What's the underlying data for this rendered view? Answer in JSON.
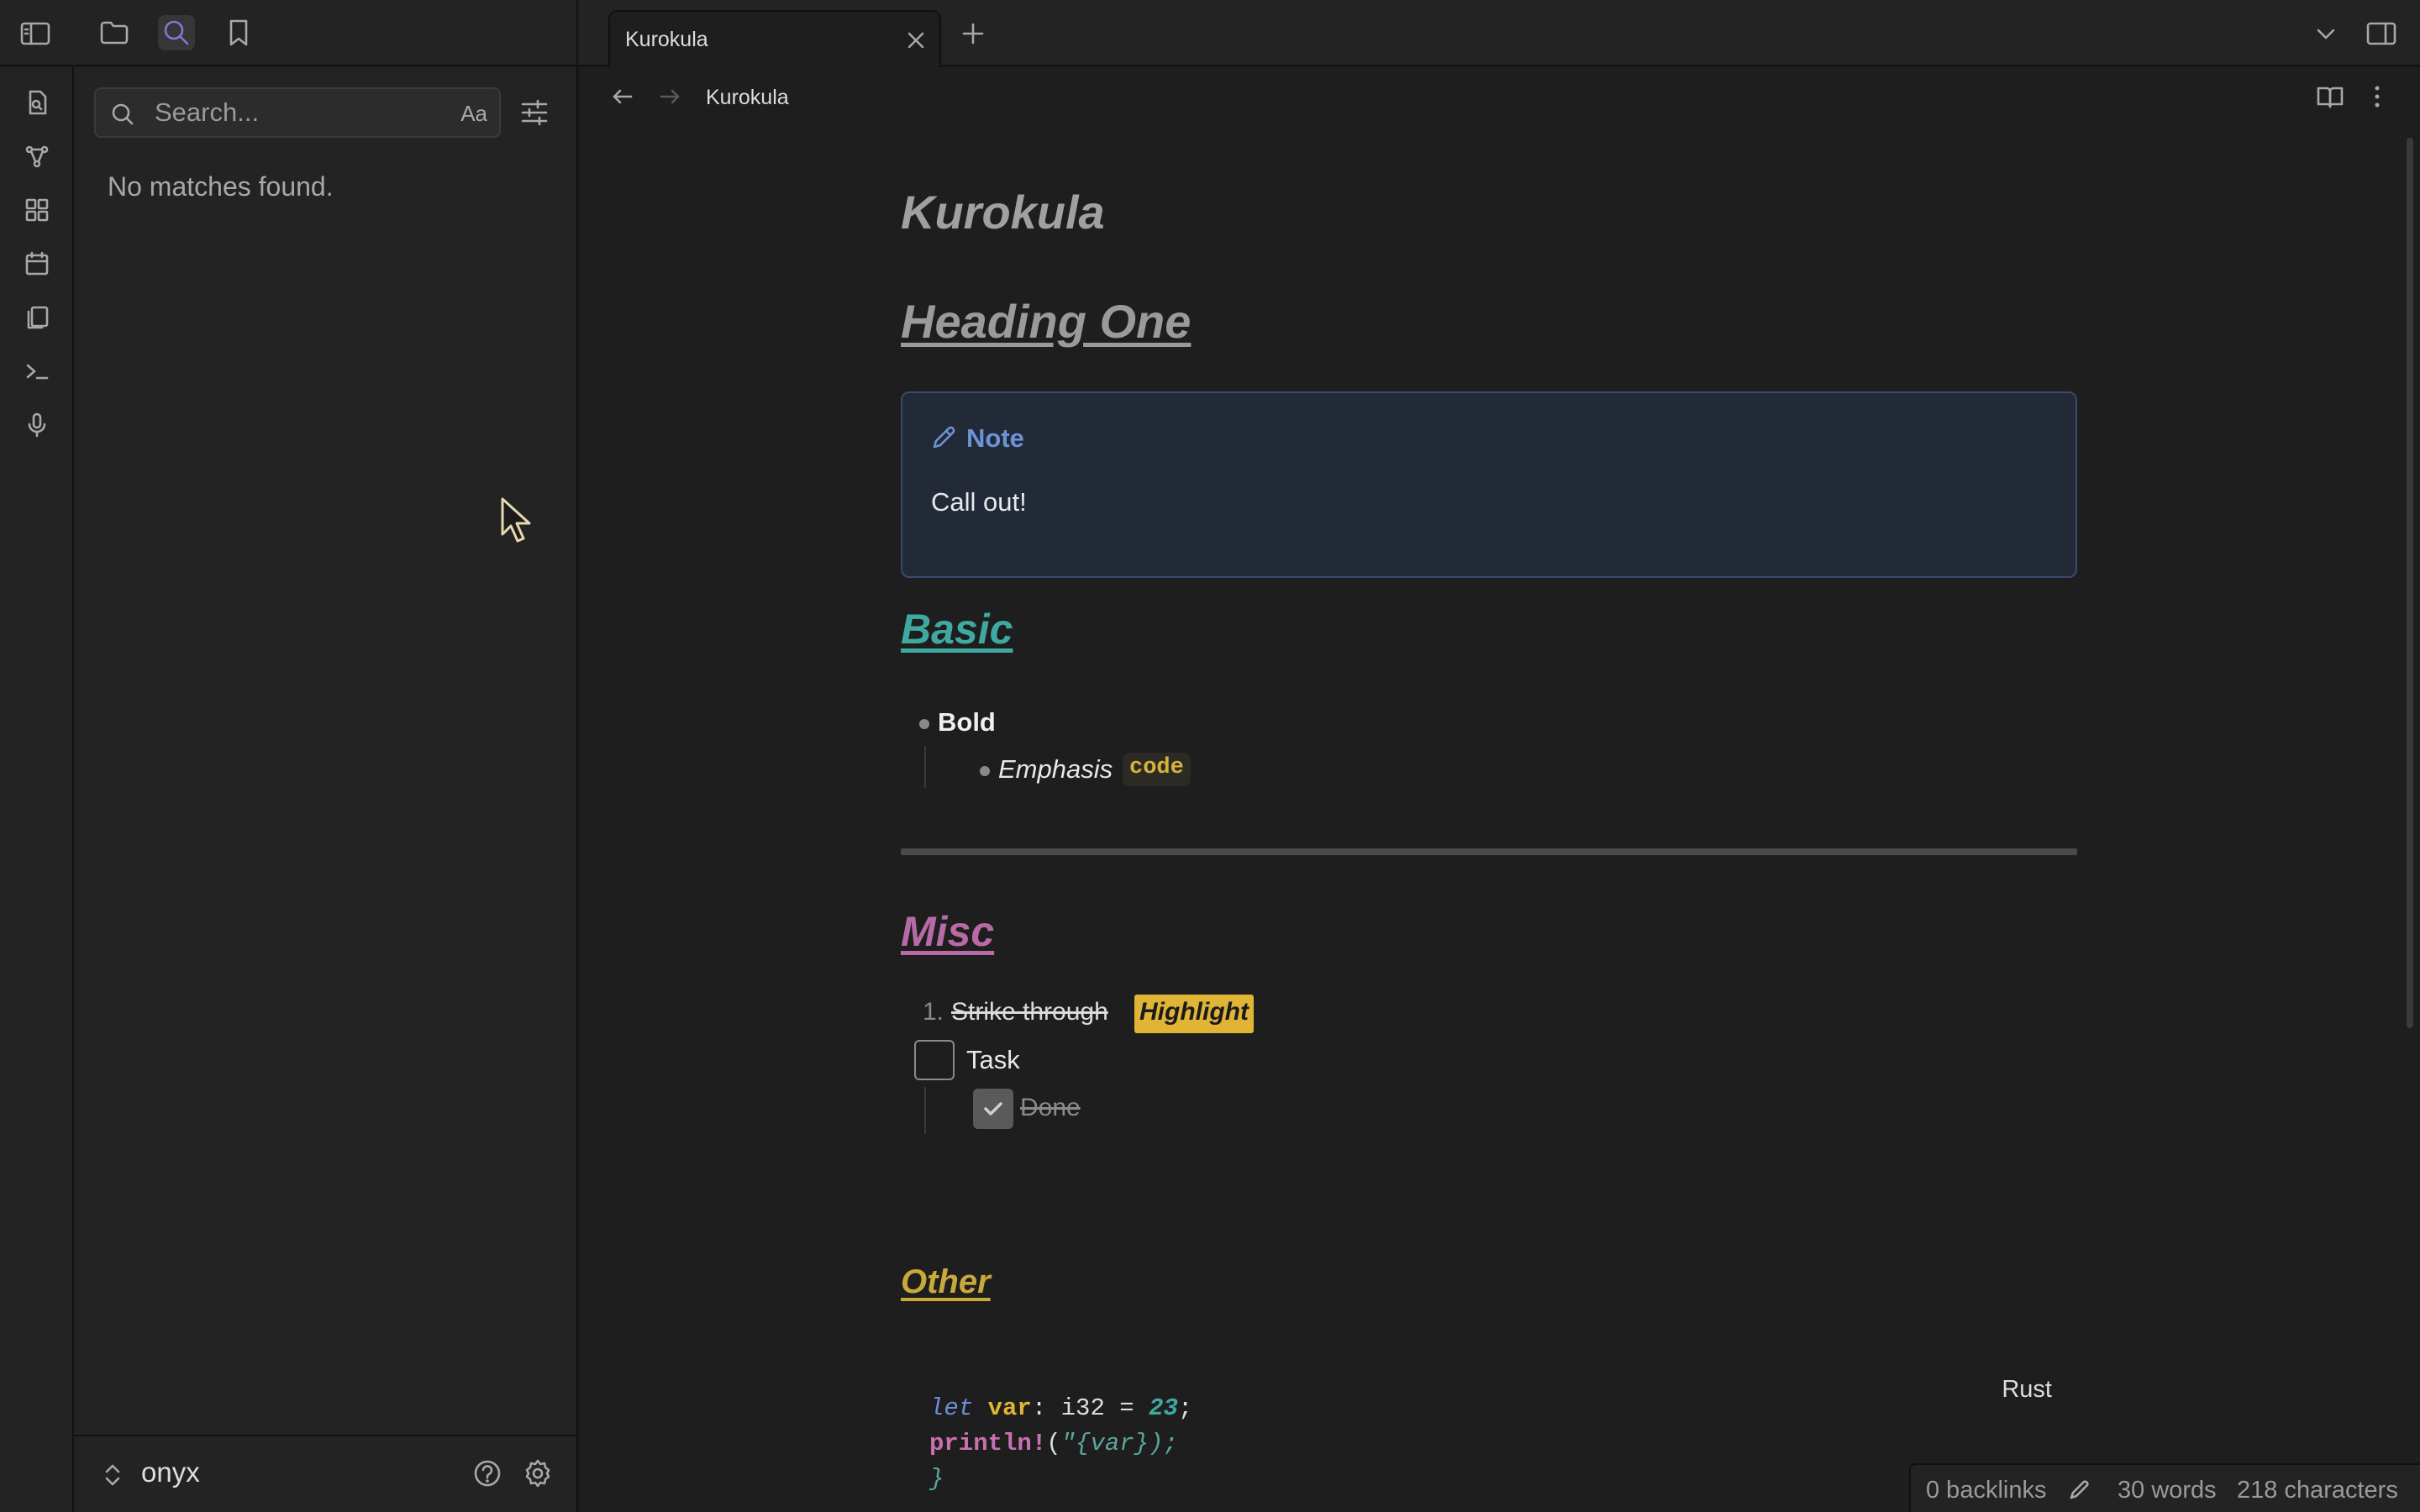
{
  "tabs": [
    {
      "title": "Kurokula"
    }
  ],
  "search": {
    "placeholder": "Search...",
    "match_case_label": "Aa",
    "empty_message": "No matches found."
  },
  "vault": {
    "name": "onyx"
  },
  "breadcrumb": "Kurokula",
  "document": {
    "title": "Kurokula",
    "heading_one": "Heading One",
    "callout": {
      "title": "Note",
      "body": "Call out!"
    },
    "basic": {
      "heading": "Basic",
      "bold_item": "Bold",
      "emphasis_item": "Emphasis",
      "inline_code": "code"
    },
    "misc": {
      "heading": "Misc",
      "ordered_number": "1.",
      "strike_text": "Strike through",
      "highlight_text": "Highlight",
      "task_label": "Task",
      "task_checked": false,
      "done_label": "Done",
      "done_checked": true
    },
    "other": {
      "heading": "Other",
      "code_language": "Rust",
      "code": {
        "line1": {
          "kw": "let",
          "var": "var",
          "rest1": ": i32 = ",
          "num": "23",
          "end": ";"
        },
        "line2": {
          "macro": "println!",
          "open": "(",
          "str": "\"{var});"
        },
        "line3": "}"
      }
    }
  },
  "status": {
    "backlinks": "0 backlinks",
    "words": "30 words",
    "characters": "218 characters"
  },
  "colors": {
    "accent": "#8a73d6",
    "callout": "#6c93d6",
    "basic": "#3fa9a1",
    "misc": "#b86aa6",
    "other": "#c9a93a",
    "highlight": "#e0b535"
  }
}
